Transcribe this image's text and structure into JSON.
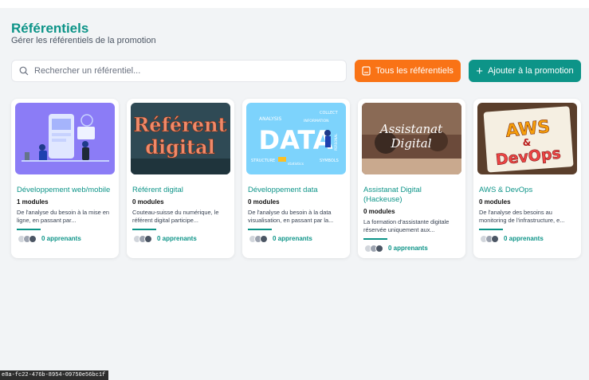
{
  "header": {
    "title": "Référentiels",
    "subtitle": "Gérer les référentiels de la promotion"
  },
  "search": {
    "placeholder": "Rechercher un référentiel...",
    "value": ""
  },
  "toolbar": {
    "all_label": "Tous les référentiels",
    "add_label": "Ajouter à la promotion"
  },
  "colors": {
    "accent": "#0d9488",
    "orange": "#f97316",
    "background": "#f2f4f6"
  },
  "cards": [
    {
      "title": "Développement web/mobile",
      "modules": "1 modules",
      "description": "De l'analyse du besoin à la mise en ligne, en passant par...",
      "learners": "0 apprenants"
    },
    {
      "title": "Référent digital",
      "modules": "0 modules",
      "description": "Couteau-suisse du numérique, le référent digital participe...",
      "learners": "0 apprenants",
      "image_text": [
        "Référent",
        "digital"
      ]
    },
    {
      "title": "Développement data",
      "modules": "0 modules",
      "description": "De l'analyse du besoin à la data visualisation, en passant par la...",
      "learners": "0 apprenants",
      "image_text": [
        "DATA",
        "ANALYSIS",
        "COLLECT",
        "INFORMATION",
        "STRUCTURE",
        "statistics",
        "SYMBOLS",
        "PERSONAL"
      ]
    },
    {
      "title": "Assistanat Digital (Hackeuse)",
      "modules": "0 modules",
      "description": "La formation d'assistante digitale réservée uniquement aux...",
      "learners": "0 apprenants",
      "image_text": [
        "Assistanat",
        "Digital"
      ]
    },
    {
      "title": "AWS & DevOps",
      "modules": "0 modules",
      "description": "De l'analyse des besoins au monitoring de l'infrastructure, e...",
      "learners": "0 apprenants",
      "image_text": [
        "AWS",
        "&",
        "DevOps"
      ]
    }
  ],
  "status_tooltip": "e8a-fc22-476b-8954-09750e56bc1f"
}
